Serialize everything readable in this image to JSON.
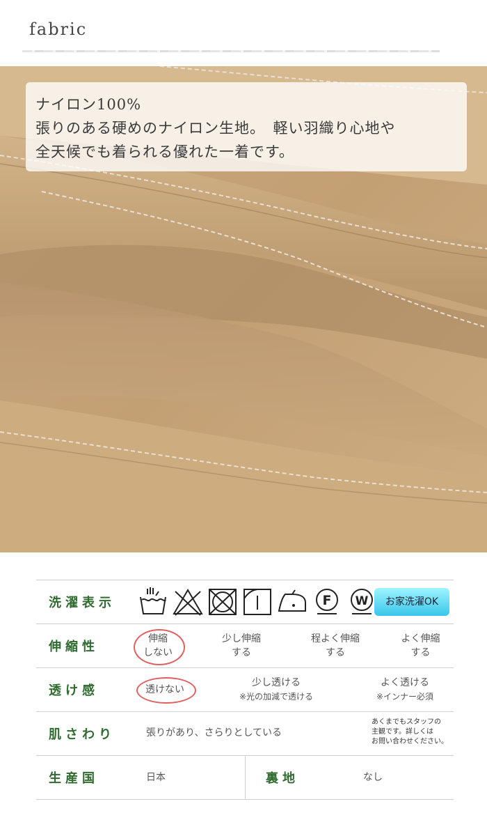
{
  "header": {
    "title": "fabric"
  },
  "caption": {
    "line1": "ナイロン100%",
    "line2": "張りのある硬めのナイロン生地。　軽い羽織り心地や",
    "line3": "全天候でも着られる優れた一着です。"
  },
  "specs": {
    "washing": {
      "label": "洗濯表示",
      "icons": [
        "hand-wash-icon",
        "no-bleach-icon",
        "no-tumble-dry-icon",
        "line-dry-icon",
        "low-iron-icon",
        "dry-clean-f-icon",
        "wet-clean-w-icon"
      ],
      "ok_label": "お家洗濯OK"
    },
    "stretch": {
      "label": "伸縮性",
      "options": [
        {
          "l1": "伸縮",
          "l2": "しない"
        },
        {
          "l1": "少し伸縮",
          "l2": "する"
        },
        {
          "l1": "程よく伸縮",
          "l2": "する"
        },
        {
          "l1": "よく伸縮",
          "l2": "する"
        }
      ],
      "selected_index": 0
    },
    "sheer": {
      "label": "透け感",
      "options": [
        {
          "l1": "透けない",
          "l2": ""
        },
        {
          "l1": "少し透ける",
          "l2": "※光の加減で透ける"
        },
        {
          "l1": "よく透ける",
          "l2": "※インナー必須"
        }
      ],
      "selected_index": 0
    },
    "texture": {
      "label": "肌さわり",
      "value": "張りがあり、さらりとしている",
      "note1": "あくまでもスタッフの",
      "note2": "主観です。詳しくは",
      "note3": "お問い合わせください。"
    },
    "origin": {
      "label": "生産国",
      "value": "日本",
      "lining_label": "裏地",
      "lining_value": "なし"
    }
  },
  "colors": {
    "label_green": "#2f6b2f",
    "circle_red": "#e06060",
    "fabric_beige": "#c8a57a"
  }
}
